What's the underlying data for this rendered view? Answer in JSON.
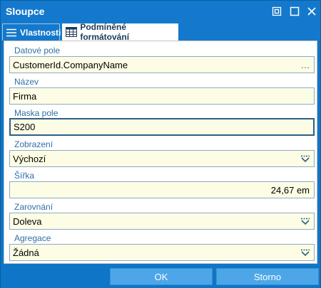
{
  "window": {
    "title": "Sloupce",
    "accent": "#1479cc",
    "controls": [
      "restore-icon",
      "maximize-icon",
      "close-icon"
    ]
  },
  "tabs": [
    {
      "label": "Vlastnosti",
      "icon": "list-icon",
      "active": true
    },
    {
      "label": "Podmíněné formátování",
      "icon": "table-grid-icon",
      "active": false
    }
  ],
  "fields": {
    "datove_pole": {
      "label": "Datové pole",
      "value": "CustomerId.CompanyName",
      "action": "…"
    },
    "nazev": {
      "label": "Název",
      "value": "Firma"
    },
    "maska": {
      "label": "Maska pole",
      "value": "S200"
    },
    "zobrazeni": {
      "label": "Zobrazení",
      "value": "Výchozí"
    },
    "sirka": {
      "label": "Šířka",
      "value": "24,67 em"
    },
    "zarovnani": {
      "label": "Zarovnání",
      "value": "Doleva"
    },
    "agregace": {
      "label": "Agregace",
      "value": "Žádná"
    }
  },
  "buttons": {
    "ok": "OK",
    "cancel": "Storno"
  }
}
